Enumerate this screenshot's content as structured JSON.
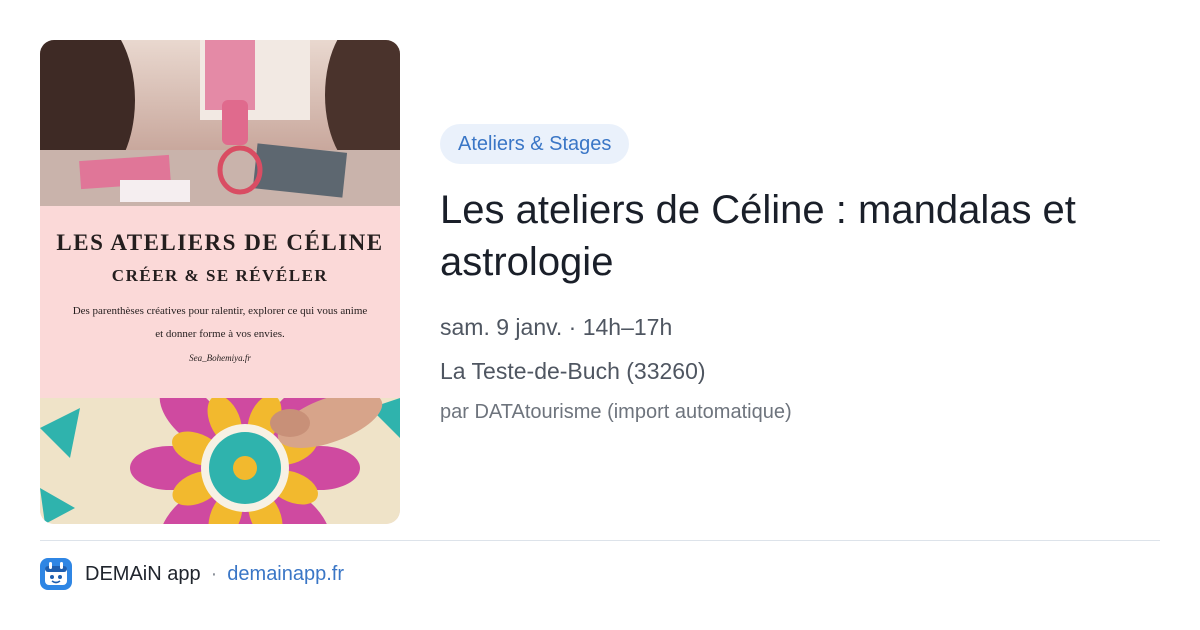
{
  "poster": {
    "title": "LES ATELIERS DE CÉLINE",
    "subtitle": "CRÉER & SE RÉVÉLER",
    "description": "Des parenthèses créatives pour ralentir, explorer ce qui vous anime et donner forme à vos envies.",
    "credit": "Sea_Bohemiya.fr"
  },
  "event": {
    "category": "Ateliers & Stages",
    "title": "Les ateliers de Céline : mandalas et astrologie",
    "datetime": "sam. 9 janv. · 14h–17h",
    "location": "La Teste-de-Buch (33260)",
    "source": "par DATAtourisme (import automatique)"
  },
  "footer": {
    "app_name": "DEMAiN app",
    "separator": "·",
    "domain": "demainapp.fr"
  },
  "colors": {
    "accent": "#3a76c6",
    "tag_background": "#eaf1fb",
    "poster_band": "#fbd9d8",
    "app_icon": "#2f86e4"
  }
}
